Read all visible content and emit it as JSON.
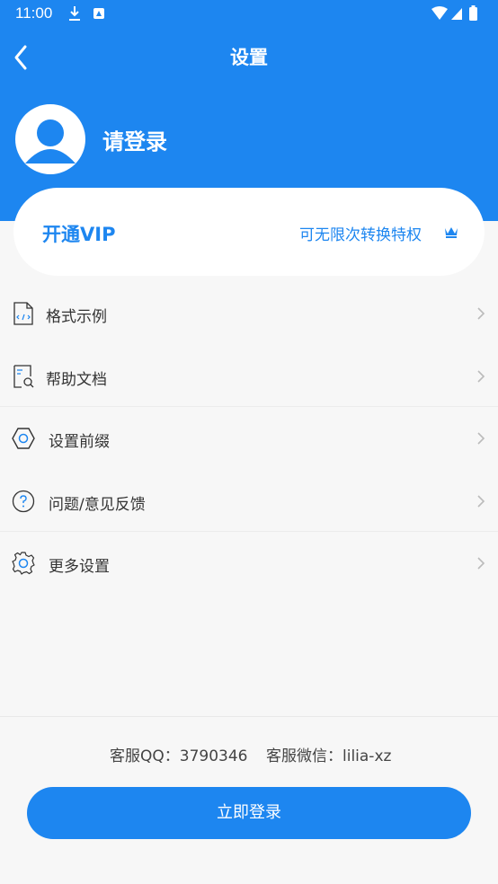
{
  "status_bar": {
    "time": "11:00"
  },
  "header": {
    "title": "设置"
  },
  "profile": {
    "name": "请登录"
  },
  "vip": {
    "title": "开通VIP",
    "subtitle": "可无限次转换特权"
  },
  "menu": [
    {
      "label": "格式示例",
      "icon": "code-file-icon"
    },
    {
      "label": "帮助文档",
      "icon": "document-search-icon"
    },
    {
      "label": "设置前缀",
      "icon": "hexagon-icon"
    },
    {
      "label": "问题/意见反馈",
      "icon": "question-icon"
    },
    {
      "label": "更多设置",
      "icon": "gear-icon"
    }
  ],
  "footer": {
    "qq": "客服QQ：3790346",
    "wechat": "客服微信：lilia-xz",
    "login_button": "立即登录"
  },
  "colors": {
    "primary": "#1d86f0",
    "background": "#f7f7f7"
  }
}
